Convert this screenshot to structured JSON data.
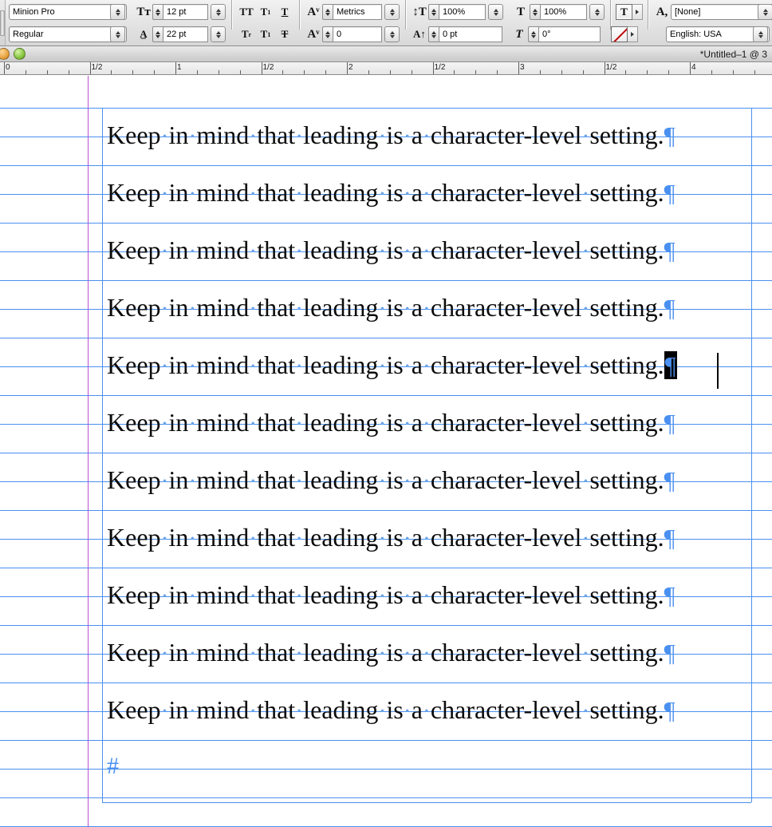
{
  "control_panel": {
    "font_family": {
      "value": "Minion Pro",
      "name": "font-family-combo"
    },
    "font_style": {
      "value": "Regular",
      "name": "font-style-combo"
    },
    "font_size": {
      "label_icon": "font-size-icon",
      "value": "12 pt"
    },
    "leading": {
      "label_icon": "leading-icon",
      "value": "22 pt"
    },
    "type_styles_row1": [
      "TT",
      "T1",
      "T"
    ],
    "type_styles_row2": [
      "Tr",
      "T1",
      "T"
    ],
    "kerning": {
      "label_icon": "kerning-icon",
      "value": "Metrics"
    },
    "tracking": {
      "label_icon": "tracking-icon",
      "value": "0"
    },
    "vertical_scale": {
      "label_icon": "vertical-scale-icon",
      "value": "100%"
    },
    "baseline_shift": {
      "label_icon": "baseline-shift-icon",
      "value": "0 pt"
    },
    "horizontal_scale": {
      "label_icon": "horizontal-scale-icon",
      "value": "100%"
    },
    "skew": {
      "label_icon": "skew-icon",
      "value": "0°"
    },
    "fill_swatch_label": "T",
    "stroke_swatch_label": "",
    "character_style": {
      "label_icon": "character-style-icon",
      "value": "[None]"
    },
    "language": {
      "value": "English: USA"
    },
    "align_buttons_row1": [
      "align-left",
      "align-center",
      "align-right",
      "align-justify-last-left"
    ],
    "align_buttons_row2": [
      "justify-left",
      "justify-center",
      "justify-right",
      "justify-all"
    ]
  },
  "document_window": {
    "title": "*Untitled–1 @ 3",
    "close_button": "close",
    "minimize_button": "minimize",
    "ruler": {
      "units": "inches",
      "labels": [
        "0",
        "1/2",
        "1",
        "1/2",
        "2",
        "1/2",
        "3",
        "1/2",
        "4"
      ]
    }
  },
  "canvas": {
    "paragraph_text": "Keep in mind that leading is a character-level setting.",
    "words": [
      "Keep",
      "in",
      "mind",
      "that",
      "leading",
      "is",
      "a",
      "character-level",
      "setting."
    ],
    "line_count": 11,
    "pilcrow_glyph": "¶",
    "space_dot_glyph": "·",
    "end_of_story_glyph": "#",
    "selected_line_index": 5,
    "colors": {
      "guide_blue": "#4a90f0",
      "margin_magenta": "#b84fd6",
      "text_black": "#0b0b0b",
      "selection_black": "#000000"
    }
  }
}
